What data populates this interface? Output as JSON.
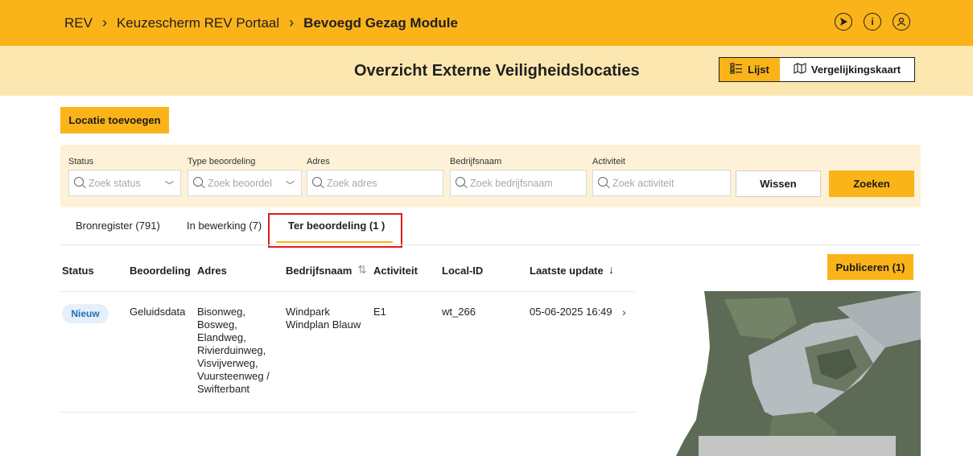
{
  "breadcrumb": {
    "items": [
      "REV",
      "Keuzescherm REV Portaal",
      "Bevoegd Gezag Module"
    ],
    "separator": "›"
  },
  "header_icons": [
    "compass-icon",
    "info-icon",
    "user-icon"
  ],
  "page_title": "Overzicht Externe Veiligheidslocaties",
  "view_toggle": {
    "list_label": "Lijst",
    "map_label": "Vergelijkingskaart"
  },
  "add_button": "Locatie toevoegen",
  "filters": {
    "status": {
      "label": "Status",
      "placeholder": "Zoek status"
    },
    "type": {
      "label": "Type beoordeling",
      "placeholder": "Zoek beoordel"
    },
    "adres": {
      "label": "Adres",
      "placeholder": "Zoek adres"
    },
    "bedrijf": {
      "label": "Bedrijfsnaam",
      "placeholder": "Zoek bedrijfsnaam"
    },
    "activiteit": {
      "label": "Activiteit",
      "placeholder": "Zoek activiteit"
    },
    "clear_label": "Wissen",
    "search_label": "Zoeken"
  },
  "tabs": [
    {
      "label": "Bronregister (791)"
    },
    {
      "label": "In bewerking (7)"
    },
    {
      "label": "Ter beoordeling (1 )"
    }
  ],
  "table": {
    "headers": {
      "status": "Status",
      "beoordeling": "Beoordeling",
      "adres": "Adres",
      "bedrijfsnaam": "Bedrijfsnaam",
      "activiteit": "Activiteit",
      "local_id": "Local-ID",
      "laatste_update": "Laatste update"
    },
    "rows": [
      {
        "status": "Nieuw",
        "beoordeling": "Geluidsdata",
        "adres": [
          "Bisonweg,",
          "Bosweg,",
          "Elandweg,",
          "Rivierduinweg,",
          "Visvijverweg,",
          "Vuursteenweg /",
          "Swifterbant"
        ],
        "bedrijfsnaam": [
          "Windpark",
          "Windplan Blauw"
        ],
        "activiteit": "E1",
        "local_id": "wt_266",
        "laatste_update": "05-06-2025 16:49"
      }
    ]
  },
  "publish_button": "Publiceren (1)",
  "colors": {
    "accent": "#fbb31a",
    "accent_light": "#fde7b0",
    "filter_bg": "#fdf2d7",
    "highlight": "#e01b1b",
    "badge_bg": "#e6f0fb",
    "badge_text": "#1f6fb2"
  }
}
